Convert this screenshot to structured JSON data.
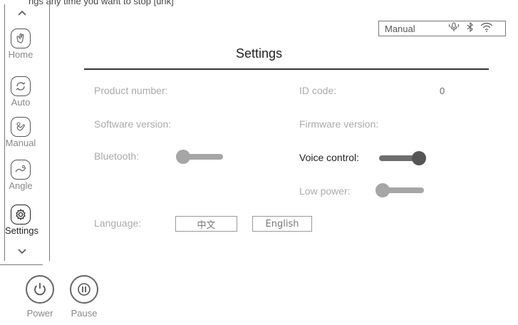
{
  "top_partial_text": "ngs any time you want to stop [unk]",
  "sidebar": {
    "items": [
      {
        "label": "Home",
        "icon": "hand-icon"
      },
      {
        "label": "Auto",
        "icon": "auto-cycle-icon"
      },
      {
        "label": "Manual",
        "icon": "manual-touch-icon"
      },
      {
        "label": "Angle",
        "icon": "angle-icon"
      },
      {
        "label": "Settings",
        "icon": "gear-icon",
        "active": true
      }
    ]
  },
  "status": {
    "mode": "Manual",
    "icons": [
      "voice-icon",
      "bluetooth-icon",
      "wifi-icon"
    ]
  },
  "page_title": "Settings",
  "settings": {
    "product_number_label": "Product number:",
    "id_code_label": "ID code:",
    "id_code_value": "0",
    "software_version_label": "Software version:",
    "firmware_version_label": "Firmware version:",
    "bluetooth_label": "Bluetooth:",
    "bluetooth_on": false,
    "voice_control_label": "Voice control:",
    "voice_control_on": true,
    "low_power_label": "Low power:",
    "low_power_on": false,
    "language_label": "Language:",
    "language_options": [
      "中文",
      "English"
    ]
  },
  "bottom": {
    "power_label": "Power",
    "pause_label": "Pause"
  }
}
